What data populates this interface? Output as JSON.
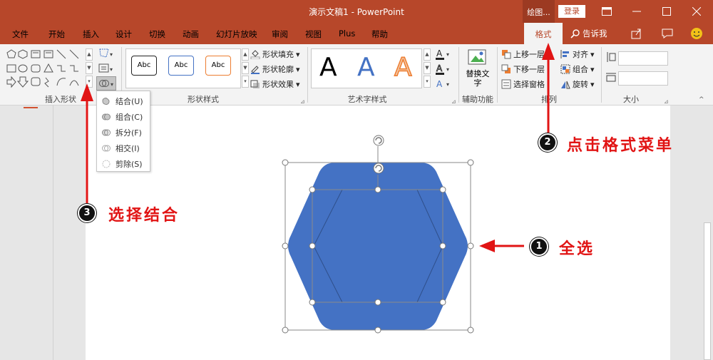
{
  "titlebar": {
    "title": "演示文稿1 - PowerPoint",
    "context_label": "绘图...",
    "login": "登录"
  },
  "tabs": [
    "文件",
    "开始",
    "插入",
    "设计",
    "切换",
    "动画",
    "幻灯片放映",
    "审阅",
    "视图",
    "Plus",
    "帮助"
  ],
  "active_tab": "格式",
  "tellme": "告诉我",
  "ribbon": {
    "groups": {
      "insert_shapes": "插入形状",
      "shape_styles": "形状样式",
      "wordart_styles": "艺术字样式",
      "accessibility": "辅助功能",
      "arrange": "排列",
      "size": "大小"
    },
    "style_samples": [
      "Abc",
      "Abc",
      "Abc"
    ],
    "shape_fill": "形状填充",
    "shape_outline": "形状轮廓",
    "shape_effects": "形状效果",
    "wordart_letter": "A",
    "alt_text": "替换文字",
    "bring_forward": "上移一层",
    "send_backward": "下移一层",
    "selection_pane": "选择窗格",
    "align": "对齐",
    "group": "组合",
    "rotate": "旋转"
  },
  "merge_menu": [
    {
      "label": "结合(U)"
    },
    {
      "label": "组合(C)"
    },
    {
      "label": "拆分(F)"
    },
    {
      "label": "相交(I)"
    },
    {
      "label": "剪除(S)"
    }
  ],
  "annotations": [
    {
      "num": "1",
      "text": "全选"
    },
    {
      "num": "2",
      "text": "点击格式菜单"
    },
    {
      "num": "3",
      "text": "选择结合"
    }
  ],
  "colors": {
    "accent": "#b7472a",
    "shape_fill": "#4472c4",
    "annotation": "#e11414"
  }
}
